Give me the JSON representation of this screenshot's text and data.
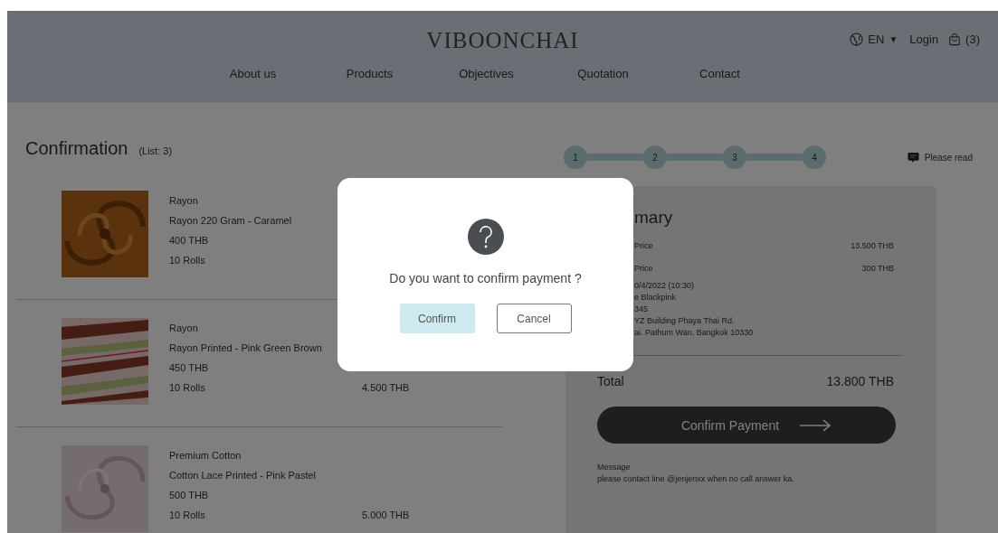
{
  "header": {
    "brand": "VIBOONCHAI",
    "language": "EN",
    "language_caret": "▼",
    "login": "Login",
    "cart_count": "(3)"
  },
  "nav": [
    "About us",
    "Products",
    "Objectives",
    "Quotation",
    "Contact"
  ],
  "page": {
    "title": "Confirmation",
    "count": "(List: 3)"
  },
  "items": [
    {
      "category": "Rayon",
      "name": "Rayon 220 Gram - Caramel",
      "price": "400 THB",
      "quantity": "10 Rolls",
      "kind": "picture"
    },
    {
      "category": "Rayon",
      "name": "Rayon Printed - Pink Green Brown",
      "price": "450 THB",
      "quantity": "10 Rolls",
      "subtotal": "4.500 THB",
      "kind": "picture"
    },
    {
      "category": "Premium Cotton",
      "name": "Cotton Lace Printed - Pink Pastel",
      "price": "500 THB",
      "quantity": "10 Rolls",
      "subtotal": "5.000 THB",
      "kind": "picture"
    }
  ],
  "steps": [
    "1",
    "2",
    "3",
    "4"
  ],
  "notice": "Please read",
  "summary": {
    "title": "mary",
    "rows": [
      {
        "label": "Price",
        "value": "13.500 THB"
      },
      {
        "label": "Price",
        "value": "300 THB"
      }
    ],
    "details": [
      "0/4/2022 (10:30)",
      "e Blackpink",
      "345",
      "YZ Building Phaya Thai Rd.",
      "ai. Pathum Wan. Bangkok 10330"
    ],
    "total_label": "Total",
    "total_value": "13.800 THB",
    "button": "Confirm Payment",
    "message_label": "Message",
    "message": "please contact line @jenjenxx when no call answer ka."
  },
  "dialog": {
    "question": "Do you want to confirm payment ?",
    "confirm": "Confirm",
    "cancel": "Cancel"
  }
}
